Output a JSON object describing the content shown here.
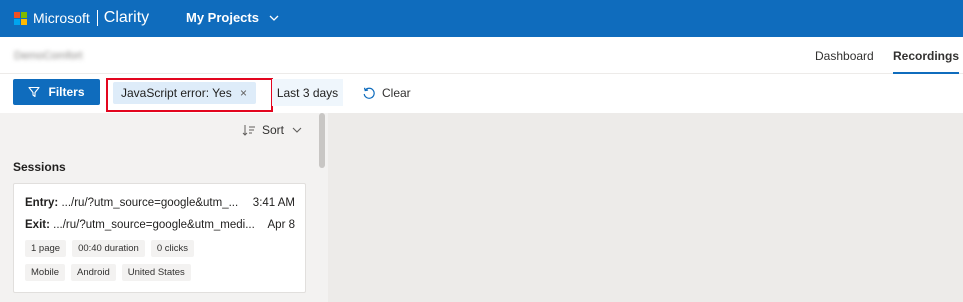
{
  "topbar": {
    "brand": "Microsoft",
    "product": "Clarity",
    "projects_label": "My Projects",
    "bg_color": "#0f6cbd"
  },
  "subheader": {
    "project_name": "DemoComfort",
    "tabs": [
      {
        "label": "Dashboard",
        "active": false
      },
      {
        "label": "Recordings",
        "active": true
      }
    ]
  },
  "toolbar": {
    "filters_label": "Filters",
    "active_filter": "JavaScript error: Yes",
    "remove_icon": "×",
    "date_range": "Last 3 days",
    "clear_label": "Clear"
  },
  "sidebar": {
    "sort_label": "Sort",
    "sessions_title": "Sessions",
    "sessions": [
      {
        "entry_label": "Entry:",
        "entry_url": ".../ru/?utm_source=google&utm_...",
        "entry_time": "3:41 AM",
        "exit_label": "Exit:",
        "exit_url": ".../ru/?utm_source=google&utm_medi...",
        "exit_date": "Apr 8",
        "stats": [
          "1 page",
          "00:40 duration",
          "0 clicks"
        ],
        "meta": [
          "Mobile",
          "Android",
          "United States"
        ]
      }
    ]
  }
}
